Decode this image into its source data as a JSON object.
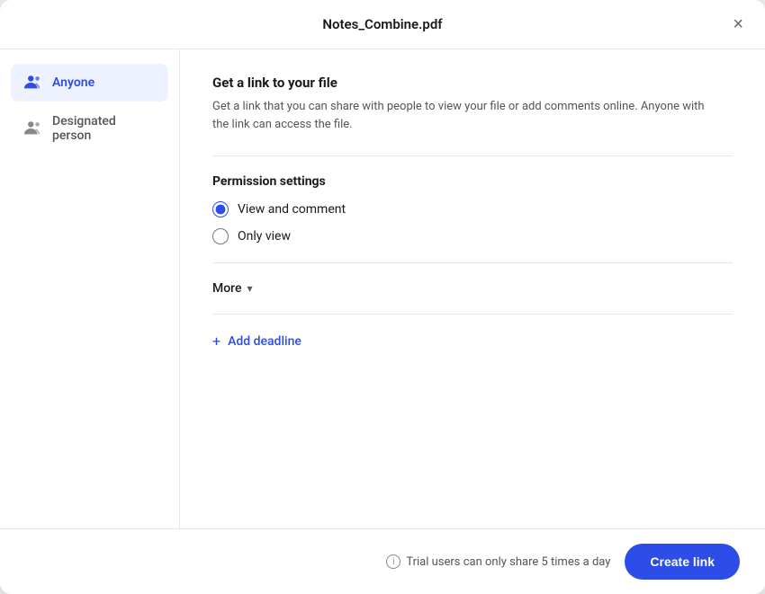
{
  "modal": {
    "title": "Notes_Combine.pdf",
    "close_label": "×"
  },
  "sidebar": {
    "items": [
      {
        "id": "anyone",
        "label": "Anyone",
        "active": true,
        "icon": "group-icon"
      },
      {
        "id": "designated",
        "label": "Designated person",
        "active": false,
        "icon": "person-icon"
      }
    ]
  },
  "content": {
    "link_section": {
      "title": "Get a link to your file",
      "description": "Get a link that you can share with people to view your file or add comments online. Anyone with the link can access the file."
    },
    "permission_section": {
      "title": "Permission settings",
      "options": [
        {
          "id": "view-comment",
          "label": "View and comment",
          "checked": true
        },
        {
          "id": "only-view",
          "label": "Only view",
          "checked": false
        }
      ]
    },
    "more": {
      "label": "More",
      "chevron": "▾"
    },
    "add_deadline": {
      "label": "Add deadline",
      "plus": "+"
    }
  },
  "footer": {
    "trial_notice": "Trial users can only share 5 times a day",
    "create_button": "Create link"
  }
}
